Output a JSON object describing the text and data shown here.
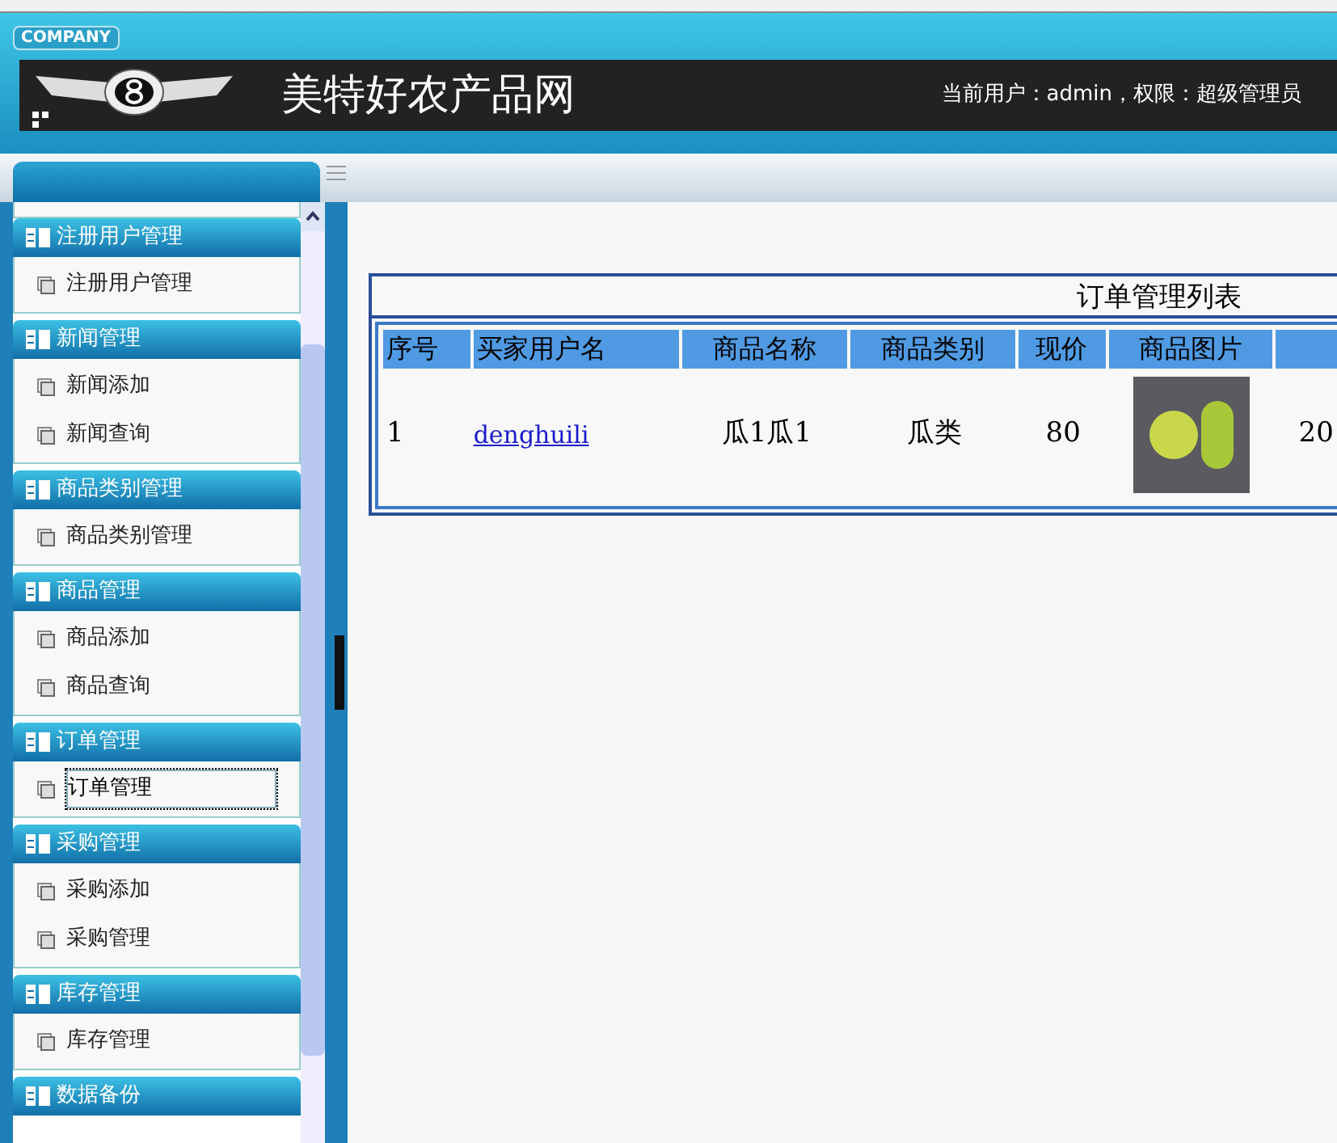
{
  "header": {
    "badge": "COMPANY",
    "site_title": "美特好农产品网",
    "user_info": "当前用户：admin，权限：超级管理员"
  },
  "sidebar": {
    "sections": [
      {
        "title": "注册用户管理",
        "items": [
          {
            "label": "注册用户管理",
            "selected": false
          }
        ]
      },
      {
        "title": "新闻管理",
        "items": [
          {
            "label": "新闻添加",
            "selected": false
          },
          {
            "label": "新闻查询",
            "selected": false
          }
        ]
      },
      {
        "title": "商品类别管理",
        "items": [
          {
            "label": "商品类别管理",
            "selected": false
          }
        ]
      },
      {
        "title": "商品管理",
        "items": [
          {
            "label": "商品添加",
            "selected": false
          },
          {
            "label": "商品查询",
            "selected": false
          }
        ]
      },
      {
        "title": "订单管理",
        "items": [
          {
            "label": "订单管理",
            "selected": true
          }
        ]
      },
      {
        "title": "采购管理",
        "items": [
          {
            "label": "采购添加",
            "selected": false
          },
          {
            "label": "采购管理",
            "selected": false
          }
        ]
      },
      {
        "title": "库存管理",
        "items": [
          {
            "label": "库存管理",
            "selected": false
          }
        ]
      },
      {
        "title": "数据备份"
      }
    ]
  },
  "table": {
    "title": "订单管理列表",
    "columns": [
      "序号",
      "买家用户名",
      "商品名称",
      "商品类别",
      "现价",
      "商品图片"
    ],
    "rows": [
      {
        "cells": [
          {
            "kind": "text",
            "text": "1"
          },
          {
            "kind": "link",
            "text": "denghuili"
          },
          {
            "kind": "text",
            "text": "瓜1瓜1"
          },
          {
            "kind": "text",
            "text": "瓜类"
          },
          {
            "kind": "text",
            "text": "80"
          },
          {
            "kind": "image"
          },
          {
            "kind": "text",
            "text": "20"
          }
        ]
      }
    ]
  }
}
